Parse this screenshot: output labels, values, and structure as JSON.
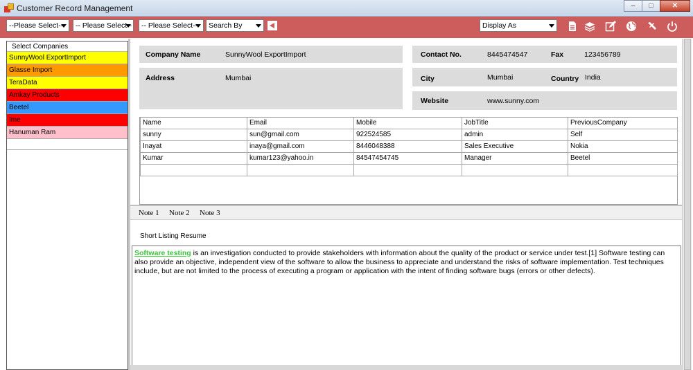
{
  "window": {
    "title": "Customer  Record Management",
    "buttons": {
      "minimize": "–",
      "maximize": "□",
      "close": "✕"
    }
  },
  "toolbar": {
    "filters": [
      "--Please Select--",
      "-- Please Select--",
      "-- Please Select--"
    ],
    "search_by": "Search By",
    "display_as": "Display As",
    "icons": [
      "document-icon",
      "layers-icon",
      "edit-icon",
      "globe-icon",
      "tools-icon",
      "power-icon"
    ],
    "accent_color": "#cd5c5c"
  },
  "sidebar": {
    "header": "Select Companies",
    "items": [
      {
        "label": "SunnyWool ExportImport",
        "color": "#ffff00"
      },
      {
        "label": "Glasse Import",
        "color": "#ff9900"
      },
      {
        "label": "TeraData",
        "color": "#ffff00"
      },
      {
        "label": "Amkay Products",
        "color": "#ff0000"
      },
      {
        "label": "Beetel",
        "color": "#3399ff"
      },
      {
        "label": "Ime",
        "color": "#ff0000"
      },
      {
        "label": "Hanuman Ram",
        "color": "#ffc0cb"
      }
    ]
  },
  "details": {
    "company_name_label": "Company Name",
    "company_name": "SunnyWool ExportImport",
    "address_label": "Address",
    "address": "Mumbai",
    "contact_label": "Contact No.",
    "contact": "8445474547",
    "fax_label": "Fax",
    "fax": "123456789",
    "city_label": "City",
    "city": "Mumbai",
    "country_label": "Country",
    "country": "India",
    "website_label": "Website",
    "website": "www.sunny.com"
  },
  "contacts": {
    "columns": [
      "Name",
      "Email",
      "Mobile",
      "JobTitle",
      "PreviousCompany"
    ],
    "rows": [
      [
        "sunny",
        "sun@gmail.com",
        "922524585",
        "admin",
        "Self"
      ],
      [
        "Inayat",
        "inaya@gmail.com",
        "8446048388",
        "Sales Executive",
        "Nokia"
      ],
      [
        "Kumar",
        "kumar123@yahoo.in",
        "84547454745",
        "Manager",
        "Beetel"
      ],
      [
        "",
        "",
        "",
        "",
        ""
      ]
    ]
  },
  "notes": {
    "tabs": [
      "Note 1",
      "Note 2",
      "Note 3"
    ],
    "title": "Short Listing Resume",
    "highlight": "Software testing",
    "body": " is an investigation conducted to provide stakeholders with information about the quality of the product or service under test.[1] Software testing can also provide an objective, independent view of the software to allow the business to appreciate and understand the risks of software implementation. Test techniques include, but are not limited to the process of executing a program or application with the intent of finding software bugs (errors or other defects)."
  }
}
